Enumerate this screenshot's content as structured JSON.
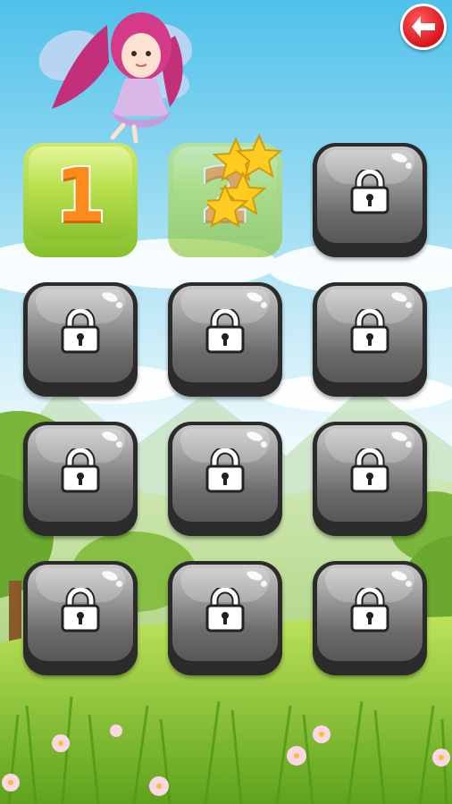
{
  "header": {
    "back_button": "back-arrow-icon"
  },
  "levels": [
    {
      "label": "1",
      "state": "unlocked",
      "stars": 0
    },
    {
      "label": "2",
      "state": "completed",
      "stars": 3
    },
    {
      "label": "",
      "state": "locked"
    },
    {
      "label": "",
      "state": "locked"
    },
    {
      "label": "",
      "state": "locked"
    },
    {
      "label": "",
      "state": "locked"
    },
    {
      "label": "",
      "state": "locked"
    },
    {
      "label": "",
      "state": "locked"
    },
    {
      "label": "",
      "state": "locked"
    },
    {
      "label": "",
      "state": "locked"
    },
    {
      "label": "",
      "state": "locked"
    },
    {
      "label": "",
      "state": "locked"
    }
  ],
  "icons": {
    "lock": "padlock-icon",
    "star": "star-icon",
    "back": "back-arrow-icon"
  },
  "colors": {
    "back_button": "#e3161c",
    "level_tile": "#9bd13a",
    "locked_tile": "#6a6a6a",
    "number": "#ff8a1c",
    "star": "#ffcc22"
  }
}
